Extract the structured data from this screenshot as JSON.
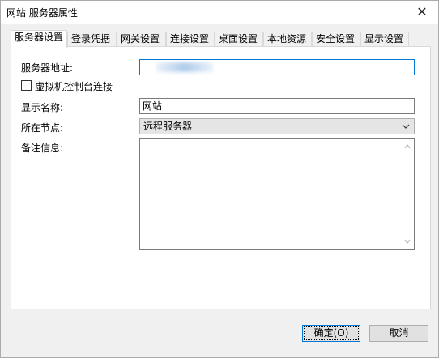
{
  "window": {
    "title": "网站 服务器属性",
    "close_symbol": "✕"
  },
  "tabs": [
    {
      "label": "服务器设置",
      "active": true
    },
    {
      "label": "登录凭据"
    },
    {
      "label": "网关设置"
    },
    {
      "label": "连接设置"
    },
    {
      "label": "桌面设置"
    },
    {
      "label": "本地资源"
    },
    {
      "label": "安全设置"
    },
    {
      "label": "显示设置"
    }
  ],
  "form": {
    "server_address_label": "服务器地址:",
    "server_address_value": "",
    "vm_console_label": "虚拟机控制台连接",
    "vm_console_checked": false,
    "display_name_label": "显示名称:",
    "display_name_value": "网站",
    "node_label": "所在节点:",
    "node_value": "远程服务器",
    "notes_label": "备注信息:",
    "notes_value": ""
  },
  "buttons": {
    "ok_label": "确定(O)",
    "cancel_label": "取消"
  }
}
